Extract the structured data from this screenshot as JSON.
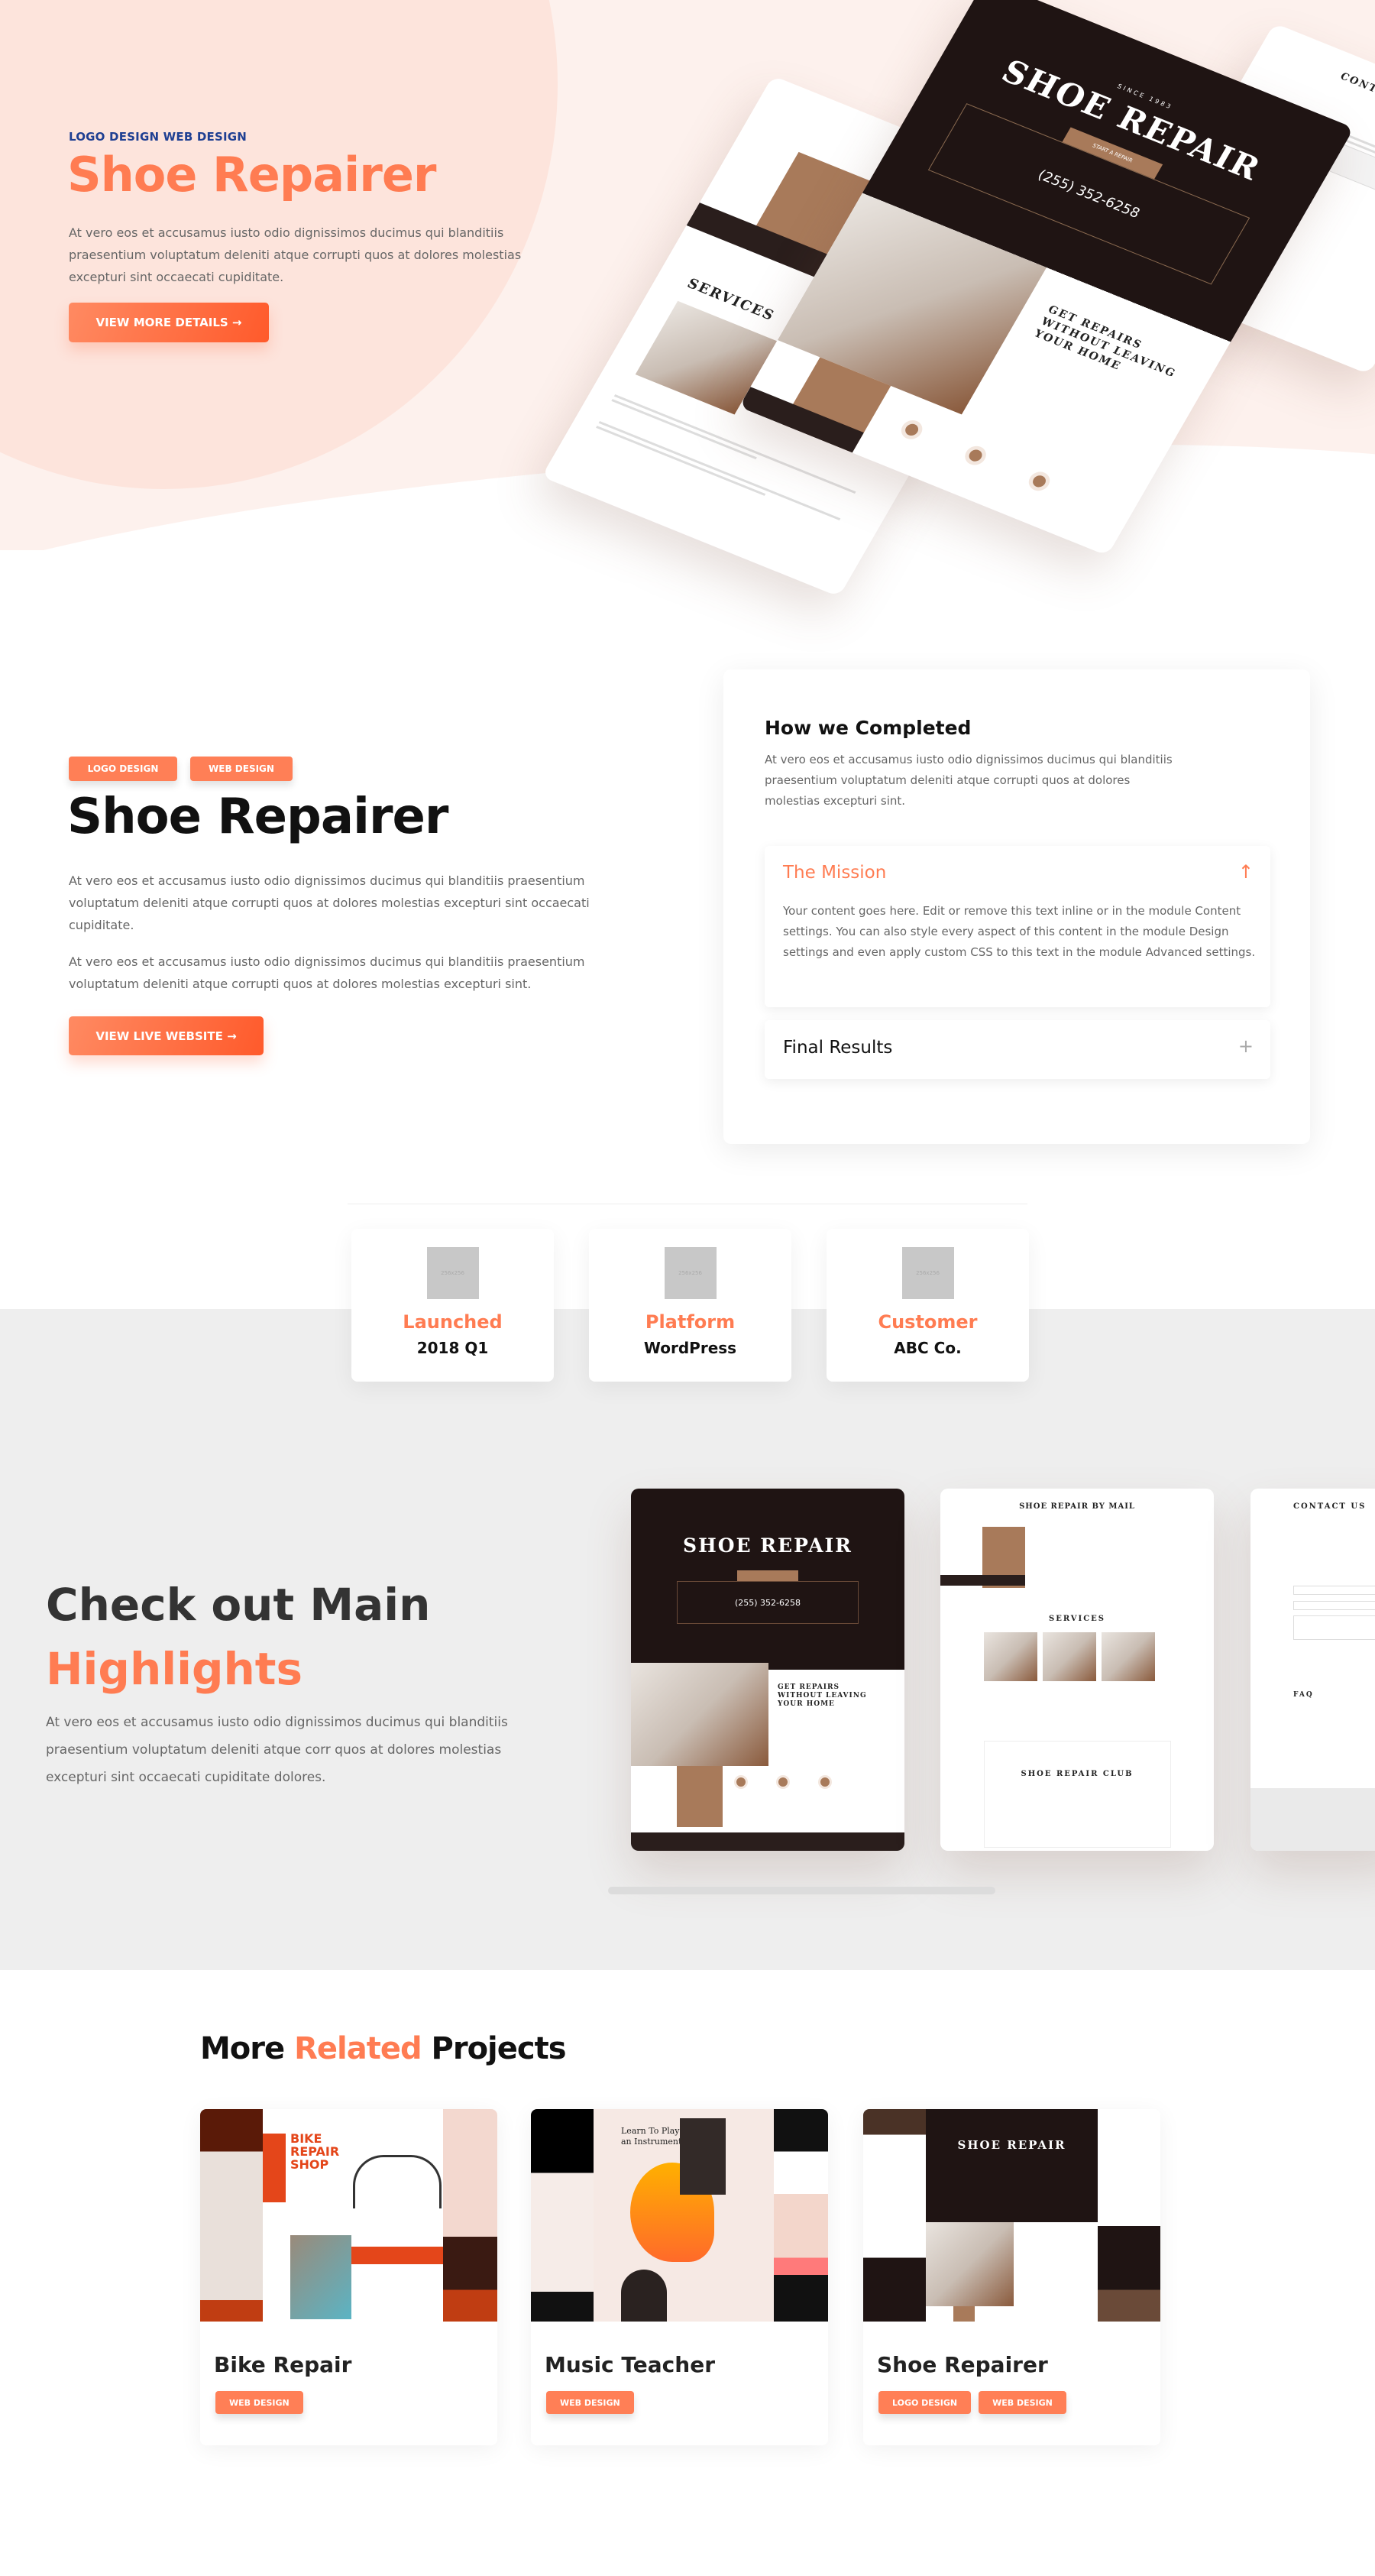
{
  "hero": {
    "kicker": "LOGO DESIGN WEB DESIGN",
    "title": "Shoe Repairer",
    "description": "At vero eos et accusamus iusto odio dignissimos ducimus qui blanditiis praesentium voluptatum deleniti atque corrupti quos at dolores molestias excepturi sint occaecati cupiditate.",
    "button": "VIEW MORE DETAILS →",
    "mockups": {
      "main_title": "SHOE REPAIR",
      "since": "SINCE 1983",
      "start_repair": "START A REPAIR",
      "phone": "(255) 352-6258",
      "headline": "GET REPAIRS WITHOUT LEAVING YOUR HOME",
      "left_title": "SHOE REPAIR",
      "services": "SERVICES",
      "contact": "CONTACT US"
    }
  },
  "project": {
    "tags": [
      "LOGO DESIGN",
      "WEB DESIGN"
    ],
    "title": "Shoe Repairer",
    "paragraphs": [
      "At vero eos et accusamus iusto odio dignissimos ducimus qui blanditiis praesentium voluptatum deleniti atque corrupti quos at dolores molestias excepturi sint occaecati cupiditate.",
      "At vero eos et accusamus iusto odio dignissimos ducimus qui blanditiis praesentium voluptatum deleniti atque corrupti quos at dolores molestias excepturi sint."
    ],
    "button": "VIEW LIVE WEBSITE →"
  },
  "process": {
    "title": "How we Completed",
    "description": "At vero eos et accusamus iusto odio dignissimos ducimus qui blanditiis praesentium voluptatum deleniti atque corrupti quos at dolores molestias excepturi sint.",
    "accordion": [
      {
        "title": "The Mission",
        "open": true,
        "icon": "arrow-up-icon",
        "body": "Your content goes here. Edit or remove this text inline or in the module Content settings. You can also style every aspect of this content in the module Design settings and even apply custom CSS to this text in the module Advanced settings."
      },
      {
        "title": "Final Results",
        "open": false,
        "icon": "plus-icon"
      }
    ]
  },
  "stats": [
    {
      "placeholder": "256x256",
      "label": "Launched",
      "value": "2018 Q1"
    },
    {
      "placeholder": "256x256",
      "label": "Platform",
      "value": "WordPress"
    },
    {
      "placeholder": "256x256",
      "label": "Customer",
      "value": "ABC Co."
    }
  ],
  "highlights": {
    "title_line1": "Check out Main",
    "title_line2": "Highlights",
    "description": "At vero eos et accusamus iusto odio dignissimos ducimus qui blanditiis praesentium voluptatum deleniti atque corr quos at dolores molestias excepturi sint occaecati cupiditate dolores.",
    "slides": {
      "home_title": "SHOE REPAIR",
      "home_phone": "(255) 352-6258",
      "home_headline": "GET REPAIRS WITHOUT LEAVING YOUR HOME",
      "mail_title": "SHOE REPAIR BY MAIL",
      "mail_services": "SERVICES",
      "mail_club": "SHOE REPAIR CLUB",
      "contact_title": "CONTACT US",
      "contact_faq": "FAQ"
    }
  },
  "related": {
    "title_prefix": "More",
    "title_accent": "Related",
    "title_suffix": "Projects",
    "projects": [
      {
        "title": "Bike Repair",
        "tags": [
          "WEB DESIGN"
        ],
        "thumb_text": "BIKE REPAIR SHOP"
      },
      {
        "title": "Music Teacher",
        "tags": [
          "WEB DESIGN"
        ],
        "thumb_text": "Learn To Play an Instrument"
      },
      {
        "title": "Shoe Repairer",
        "tags": [
          "LOGO DESIGN",
          "WEB DESIGN"
        ],
        "thumb_text": "SHOE REPAIR"
      }
    ]
  },
  "colors": {
    "accent": "#ff7c52",
    "kicker": "#1f3f92",
    "mock_brown": "#a87a5a",
    "mock_dark": "#1f1413",
    "section_gray": "#eeeeee"
  }
}
